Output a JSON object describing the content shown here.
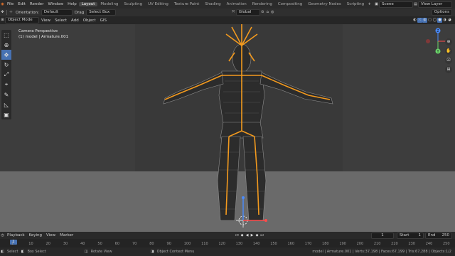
{
  "menu": {
    "items": [
      "File",
      "Edit",
      "Render",
      "Window",
      "Help"
    ],
    "workspaces": [
      "Layout",
      "Modeling",
      "Sculpting",
      "UV Editing",
      "Texture Paint",
      "Shading",
      "Animation",
      "Rendering",
      "Compositing",
      "Geometry Nodes",
      "Scripting"
    ],
    "active_workspace": "Layout",
    "scene": "Scene",
    "view_layer": "View Layer"
  },
  "tool_header": {
    "orientation_label": "Orientation:",
    "orientation_value": "Default",
    "drag_label": "Drag",
    "drag_value": "Select Box",
    "transform_value": "Global",
    "options_label": "Options"
  },
  "view_header": {
    "mode": "Object Mode",
    "menus": [
      "View",
      "Select",
      "Add",
      "Object",
      "GIS"
    ]
  },
  "viewport": {
    "camera_label": "Camera Perspective",
    "collection_label": "(1) model | Armature.001",
    "gizmo_axes": [
      "X",
      "Y",
      "Z"
    ]
  },
  "timeline": {
    "playback_label": "Playback",
    "keying_label": "Keying",
    "view_label": "View",
    "marker_label": "Marker",
    "current_frame": "1",
    "start_label": "Start",
    "start_value": "1",
    "end_label": "End",
    "end_value": "250",
    "ruler_ticks": [
      "1",
      "10",
      "20",
      "30",
      "40",
      "50",
      "60",
      "70",
      "80",
      "90",
      "100",
      "110",
      "120",
      "130",
      "140",
      "150",
      "160",
      "170",
      "180",
      "190",
      "200",
      "210",
      "220",
      "230",
      "240",
      "250"
    ]
  },
  "status": {
    "select": "Select",
    "box_select": "Box Select",
    "rotate_view": "Rotate View",
    "context_menu": "Object Context Menu",
    "stats": "model | Armature.001 | Verts:37,198 | Faces:67,199 | Tris:67,288 | Objects:1/2"
  },
  "colors": {
    "accent": "#4772b3",
    "bone": "#f39a1e",
    "mesh": "#9a9a9a"
  }
}
